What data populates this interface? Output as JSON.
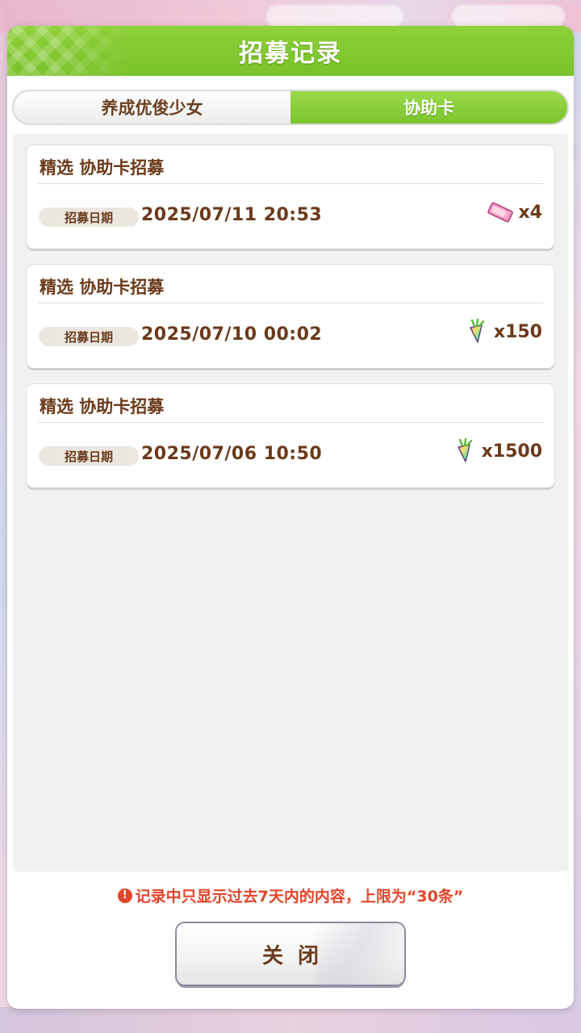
{
  "dialog": {
    "title": "招募记录",
    "tabs": [
      {
        "label": "养成优俊少女",
        "active": false
      },
      {
        "label": "协助卡",
        "active": true
      }
    ]
  },
  "records": [
    {
      "title": "精选  协助卡招募",
      "date_label": "招募日期",
      "date": "2025/07/11  20:53",
      "reward_icon": "ticket-icon",
      "reward_count": "x4"
    },
    {
      "title": "精选  协助卡招募",
      "date_label": "招募日期",
      "date": "2025/07/10  00:02",
      "reward_icon": "carrot-gem-icon",
      "reward_count": "x150"
    },
    {
      "title": "精选  协助卡招募",
      "date_label": "招募日期",
      "date": "2025/07/06  10:50",
      "reward_icon": "carrot-gem-icon",
      "reward_count": "x1500"
    }
  ],
  "notice": "记录中只显示过去7天内的内容，上限为“30条”",
  "close_button": {
    "label": "关闭"
  },
  "colors": {
    "header_green": "#84c932",
    "text_brown": "#6b3a1a",
    "notice_red": "#e2452a"
  }
}
